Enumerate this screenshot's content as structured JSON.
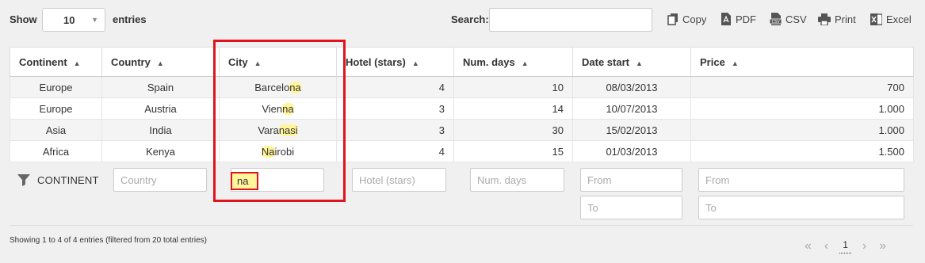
{
  "toolbar": {
    "show_label": "Show",
    "length_value": "10",
    "entries_label": "entries",
    "search_label": "Search:",
    "search_value": "",
    "buttons": {
      "copy": "Copy",
      "pdf": "PDF",
      "csv": "CSV",
      "print": "Print",
      "excel": "Excel"
    }
  },
  "table": {
    "columns": [
      "Continent",
      "Country",
      "City",
      "Hotel (stars)",
      "Num. days",
      "Date start",
      "Price"
    ],
    "rows": [
      {
        "continent": "Europe",
        "country": "Spain",
        "city_pre": "Barcelo",
        "city_hl": "na",
        "city_post": "",
        "stars": "4",
        "days": "10",
        "date": "08/03/2013",
        "price": "700"
      },
      {
        "continent": "Europe",
        "country": "Austria",
        "city_pre": "Vien",
        "city_hl": "na",
        "city_post": "",
        "stars": "3",
        "days": "14",
        "date": "10/07/2013",
        "price": "1.000"
      },
      {
        "continent": "Asia",
        "country": "India",
        "city_pre": "Vara",
        "city_hl": "nasi",
        "city_post": "",
        "stars": "3",
        "days": "30",
        "date": "15/02/2013",
        "price": "1.000"
      },
      {
        "continent": "Africa",
        "country": "Kenya",
        "city_pre": "",
        "city_hl": "Na",
        "city_post": "irobi",
        "stars": "4",
        "days": "15",
        "date": "01/03/2013",
        "price": "1.500"
      }
    ]
  },
  "filters": {
    "continent_label": "CONTINENT",
    "country_placeholder": "Country",
    "city_value": "na",
    "hotel_placeholder": "Hotel (stars)",
    "days_placeholder": "Num. days",
    "date_from_placeholder": "From",
    "date_to_placeholder": "To",
    "price_from_placeholder": "From",
    "price_to_placeholder": "To"
  },
  "footer": {
    "info": "Showing 1 to 4 of 4 entries (filtered from 20 total entries)",
    "pager": {
      "first": "«",
      "prev": "‹",
      "page": "1",
      "next": "›",
      "last": "»"
    }
  },
  "colors": {
    "highlight": "#fff59a",
    "annotation": "#e0141e"
  }
}
